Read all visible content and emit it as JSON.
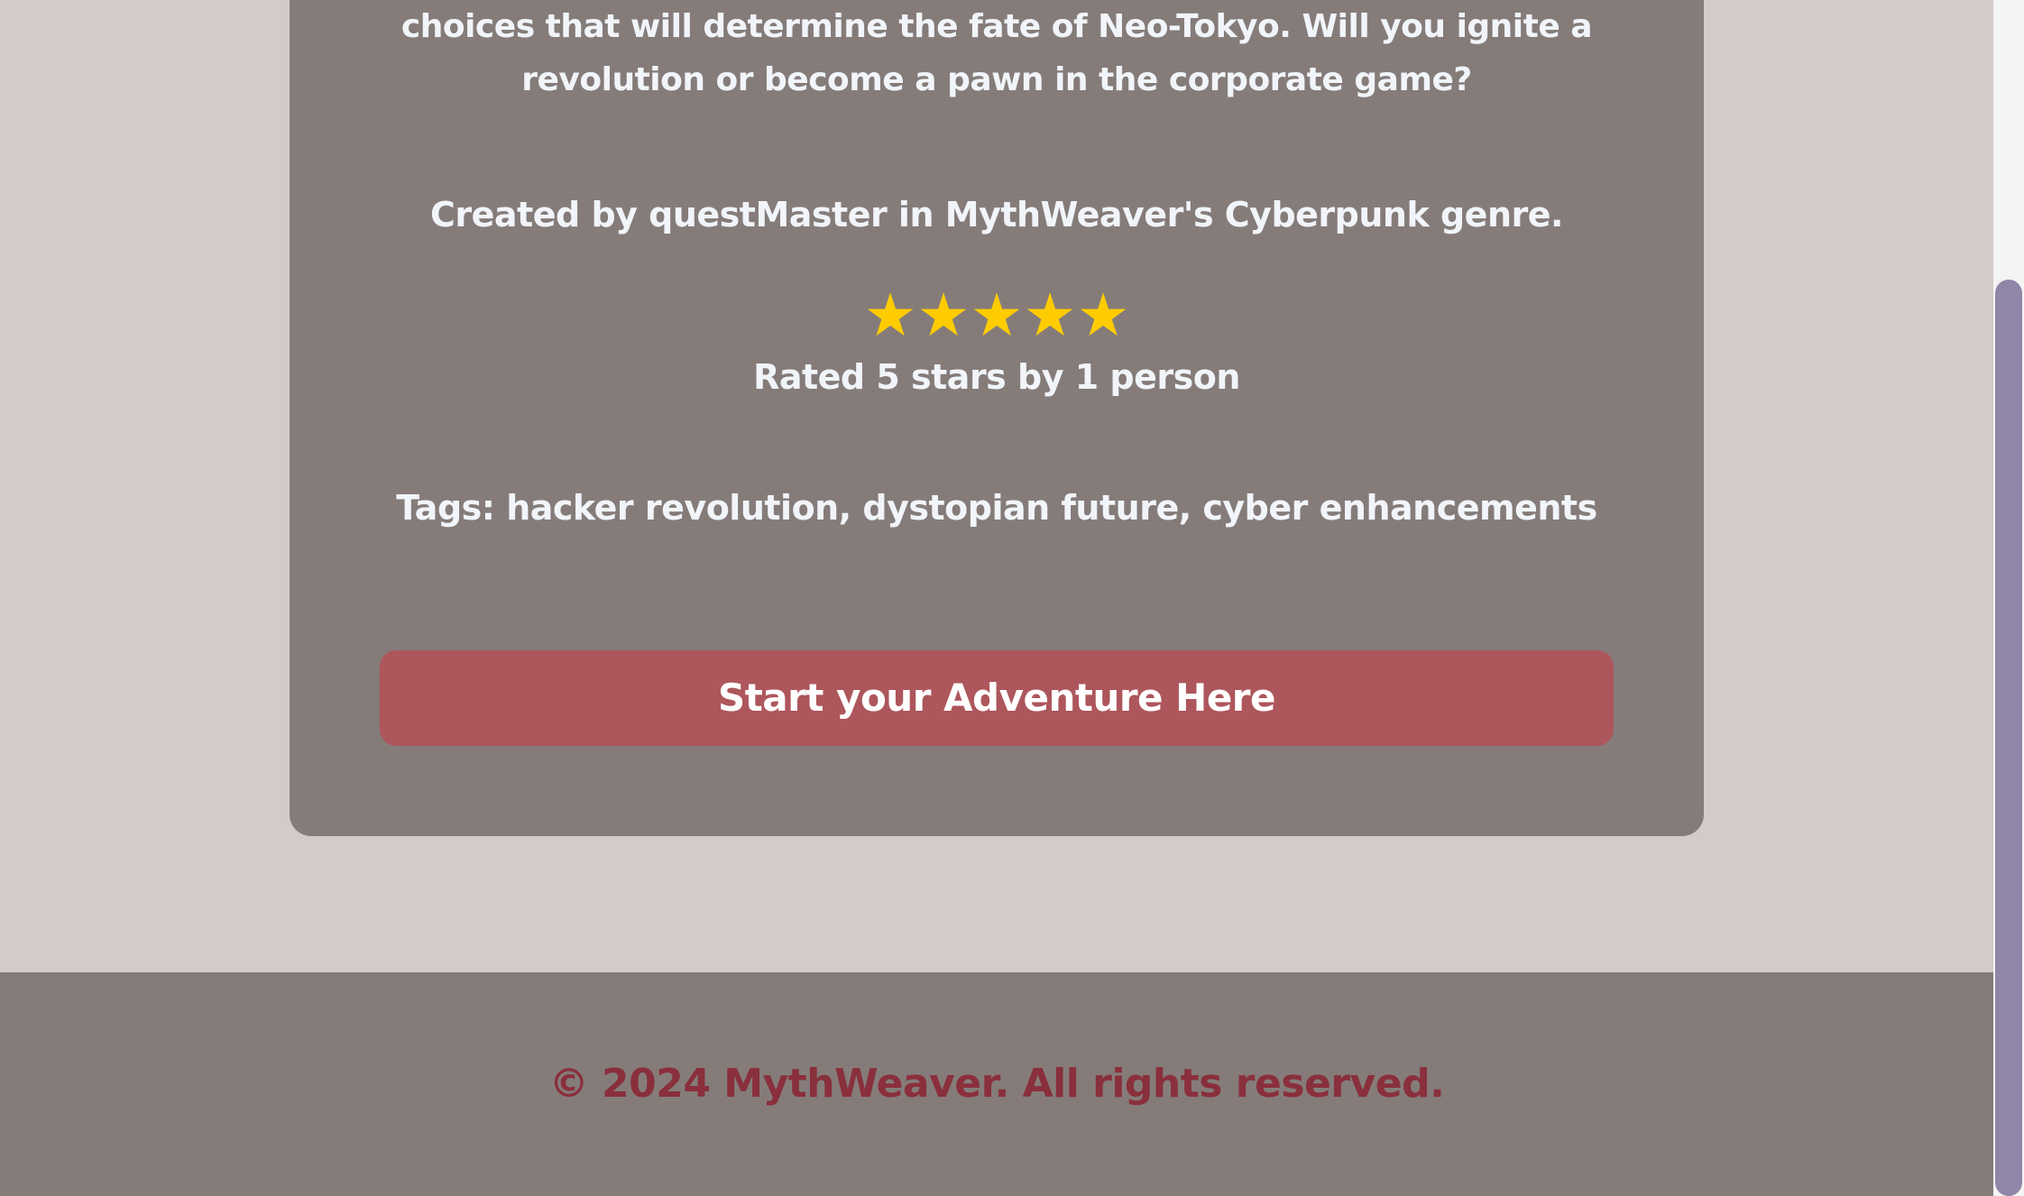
{
  "story": {
    "description": "choices that will determine the fate of Neo-Tokyo. Will you ignite a revolution or become a pawn in the corporate game?",
    "created_by": "Created by questMaster in MythWeaver's Cyberpunk genre.",
    "rating": {
      "stars": 5,
      "star_glyph": "★",
      "star_color": "#ffcc00",
      "label": "Rated 5 stars by 1 person"
    },
    "tags": "Tags: hacker revolution, dystopian future, cyber enhancements",
    "start_button_label": "Start your Adventure Here"
  },
  "footer": {
    "copyright": "© 2024 MythWeaver. All rights reserved."
  },
  "colors": {
    "page_background": "#d4cac8",
    "card_background": "#857c7a",
    "button_background": "#ad565c",
    "footer_text": "#8a2f3c",
    "scrollbar_thumb": "#8f86a8"
  }
}
